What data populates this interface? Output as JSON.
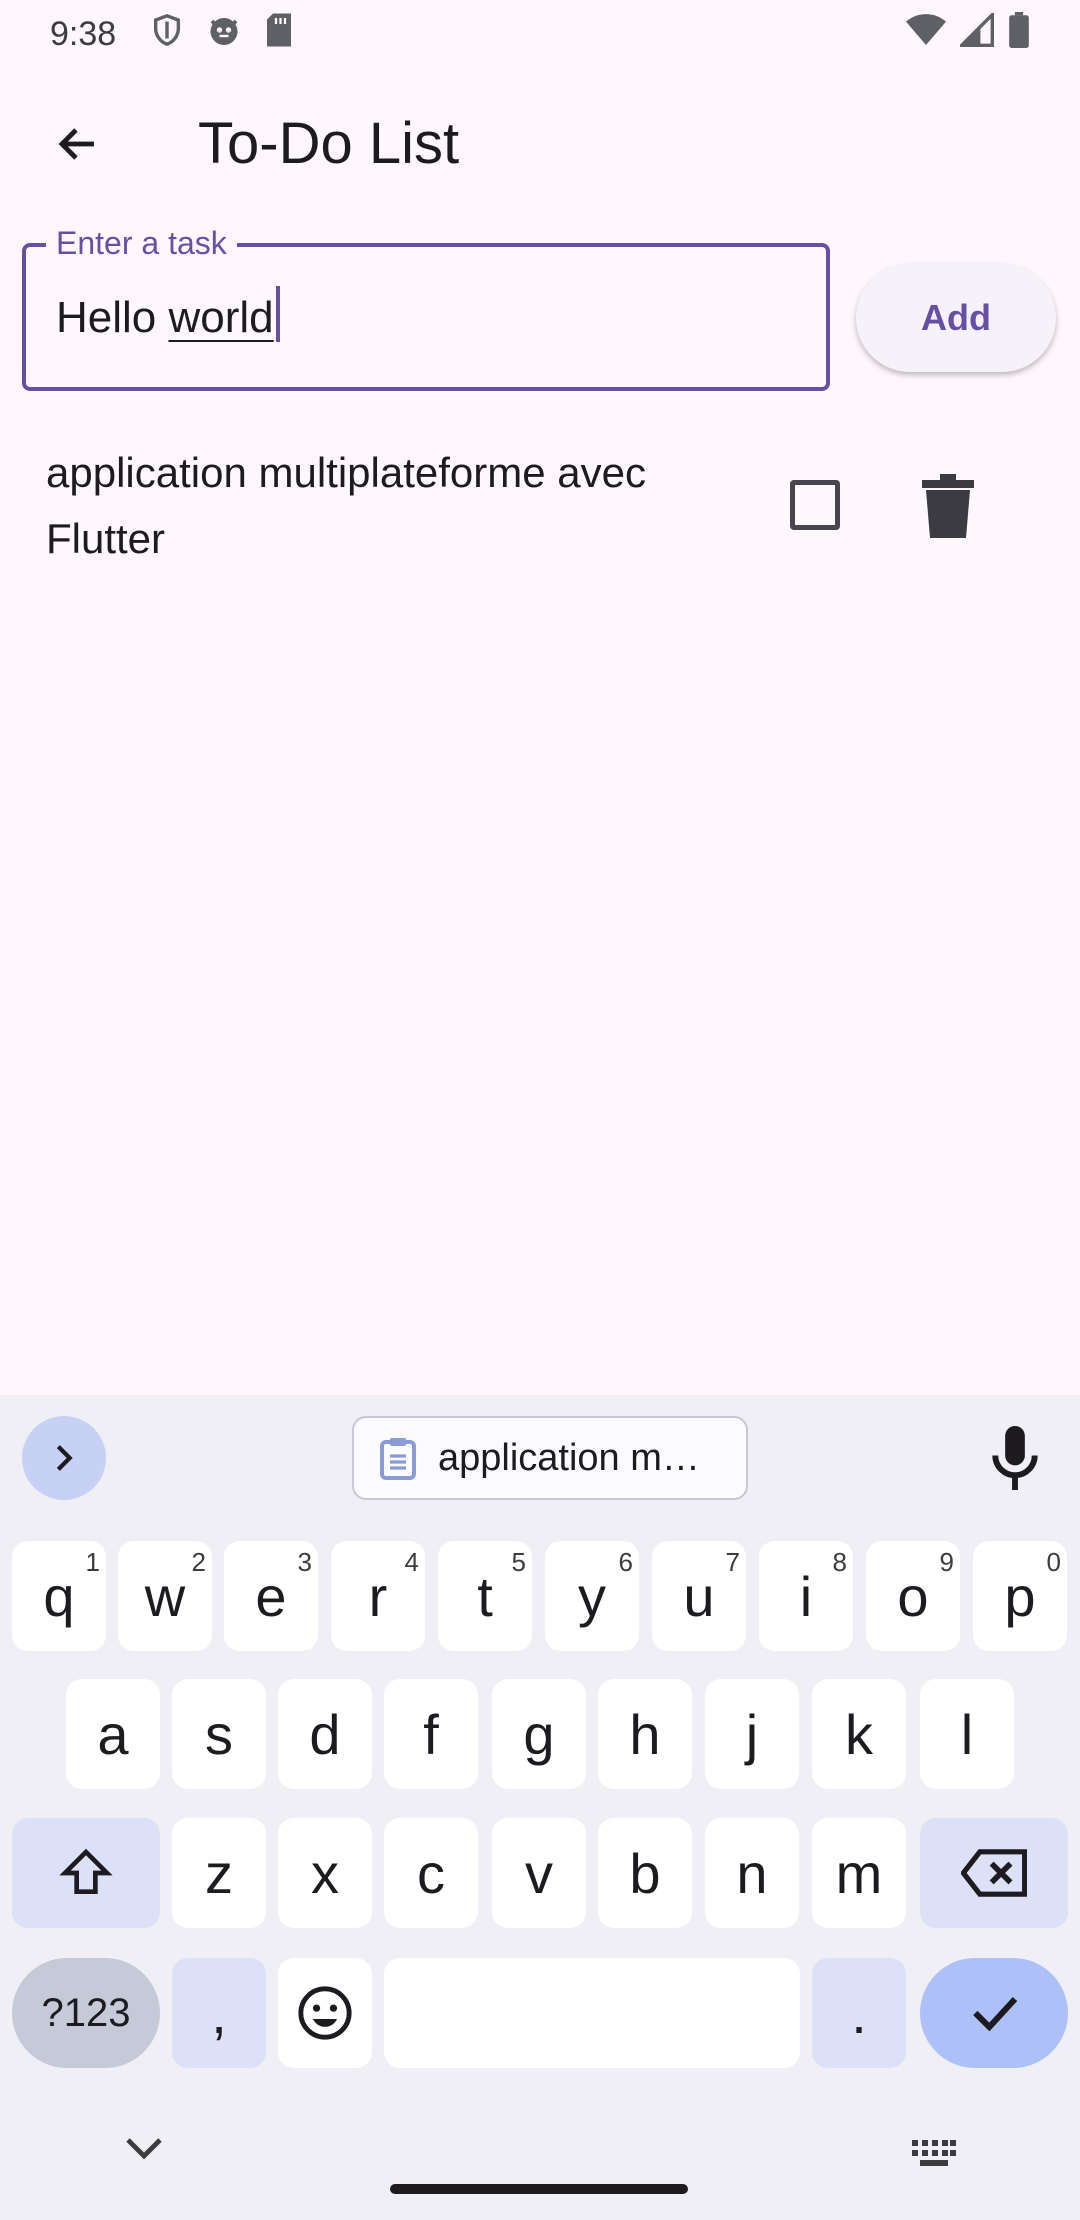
{
  "status_bar": {
    "time": "9:38"
  },
  "app_bar": {
    "title": "To-Do List"
  },
  "task_input": {
    "label": "Enter a task",
    "value_plain": "Hello ",
    "value_underlined": "world"
  },
  "add_button": {
    "label": "Add"
  },
  "tasks": [
    {
      "text": "application multiplateforme avec Flutter",
      "done": false
    }
  ],
  "keyboard": {
    "clipboard_suggestion": "application m…",
    "row1": [
      {
        "k": "q",
        "h": "1"
      },
      {
        "k": "w",
        "h": "2"
      },
      {
        "k": "e",
        "h": "3"
      },
      {
        "k": "r",
        "h": "4"
      },
      {
        "k": "t",
        "h": "5"
      },
      {
        "k": "y",
        "h": "6"
      },
      {
        "k": "u",
        "h": "7"
      },
      {
        "k": "i",
        "h": "8"
      },
      {
        "k": "o",
        "h": "9"
      },
      {
        "k": "p",
        "h": "0"
      }
    ],
    "row2": [
      "a",
      "s",
      "d",
      "f",
      "g",
      "h",
      "j",
      "k",
      "l"
    ],
    "row3": [
      "z",
      "x",
      "c",
      "v",
      "b",
      "n",
      "m"
    ],
    "symbols_label": "?123",
    "comma": ",",
    "period": "."
  },
  "colors": {
    "accent": "#6750a4",
    "background": "#fef7fc",
    "keyboard_bg": "#f0eff6"
  }
}
